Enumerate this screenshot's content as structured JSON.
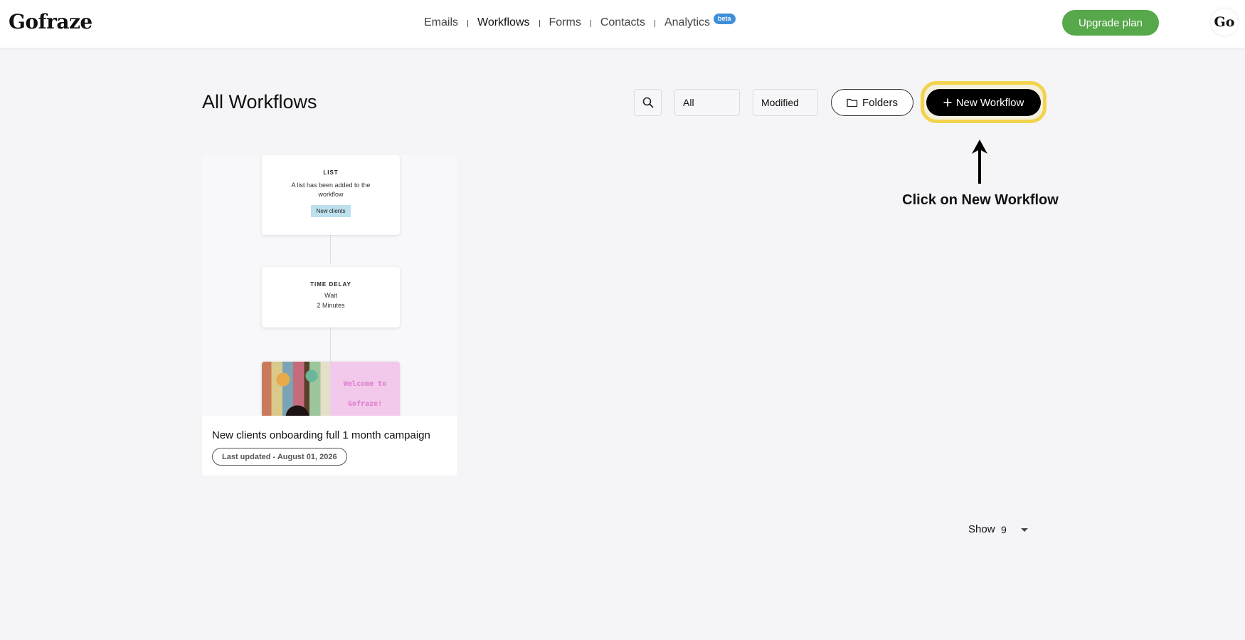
{
  "app": {
    "logo": "Gofraze",
    "avatar_text": "Go"
  },
  "nav": {
    "items": [
      {
        "label": "Emails",
        "active": false
      },
      {
        "label": "Workflows",
        "active": true
      },
      {
        "label": "Forms",
        "active": false
      },
      {
        "label": "Contacts",
        "active": false
      },
      {
        "label": "Analytics",
        "active": false,
        "badge": "beta"
      }
    ]
  },
  "header": {
    "upgrade_label": "Upgrade plan"
  },
  "page": {
    "title": "All Workflows",
    "search_icon": "search-icon",
    "filter_value": "All",
    "sort_value": "Modified",
    "folders_label": "Folders",
    "new_workflow_label": "New Workflow"
  },
  "annotation": {
    "text": "Click on New Workflow",
    "highlight_color": "#f2d44c"
  },
  "workflow_card": {
    "title": "New clients onboarding full 1 month campaign",
    "updated": "Last updated - August 01, 2026",
    "nodes": {
      "list": {
        "heading": "LIST",
        "text": "A list has been added to the workflow",
        "tag": "New clients"
      },
      "delay": {
        "heading": "TIME DELAY",
        "line1": "Wait",
        "line2": "2 Minutes"
      },
      "email": {
        "line1": "Welcome to",
        "line2": "Gofraze!"
      }
    }
  },
  "pagination": {
    "show_label": "Show",
    "per_page": "9"
  },
  "colors": {
    "upgrade": "#56a84a",
    "beta": "#3f8ed8",
    "primary": "#000000"
  }
}
